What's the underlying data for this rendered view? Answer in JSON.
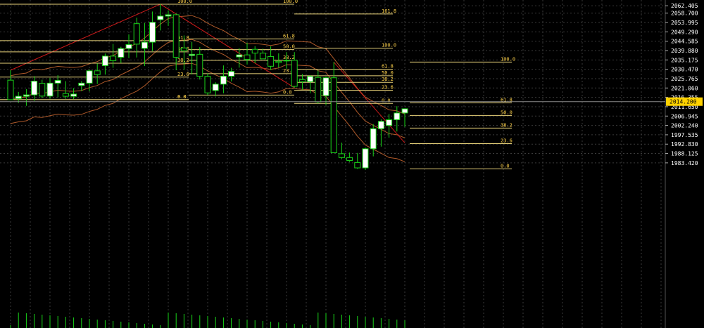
{
  "chart_data": {
    "type": "candlestick",
    "title": "",
    "grid": true,
    "colors": {
      "background": "#000000",
      "grid": "#3a3a3a",
      "bull": "#ffffff",
      "bear": "#000000",
      "wick": "#19d419",
      "fib_line": "#e8d27a",
      "fib_text": "#ffd24a",
      "trend": "#cc1a1a",
      "bands": "#b05a2a",
      "volume": "#19d419",
      "price_tag": "#ffd200",
      "axis_text": "#ffffff"
    },
    "ylim": [
      1900.4,
      2065.3
    ],
    "y_ticks": [
      "2062.405",
      "2058.700",
      "2053.995",
      "2049.290",
      "2044.585",
      "2039.880",
      "2035.175",
      "2030.470",
      "2025.765",
      "2021.060",
      "2016.355",
      "2011.650",
      "2006.945",
      "2002.240",
      "1997.535",
      "1992.830",
      "1988.125",
      "1983.420"
    ],
    "y_tick_values": [
      2062.405,
      2058.7,
      2053.995,
      2049.29,
      2044.585,
      2039.88,
      2035.175,
      2030.47,
      2025.765,
      2021.06,
      2016.355,
      2011.65,
      2006.945,
      2002.24,
      1997.535,
      1992.83,
      1988.125,
      1983.42
    ],
    "current_price": "2014.200",
    "current_price_value": 2014.2,
    "candles": [
      {
        "o": 2025.0,
        "h": 2030.0,
        "l": 2015.2,
        "c": 2015.2
      },
      {
        "o": 2015.7,
        "h": 2019.1,
        "l": 2013.5,
        "c": 2016.9
      },
      {
        "o": 2016.9,
        "h": 2020.5,
        "l": 2012.1,
        "c": 2017.6
      },
      {
        "o": 2017.6,
        "h": 2027.0,
        "l": 2014.6,
        "c": 2024.5
      },
      {
        "o": 2023.4,
        "h": 2025.2,
        "l": 2015.9,
        "c": 2017.0
      },
      {
        "o": 2017.0,
        "h": 2026.0,
        "l": 2015.7,
        "c": 2023.5
      },
      {
        "o": 2023.5,
        "h": 2027.5,
        "l": 2016.4,
        "c": 2024.9
      },
      {
        "o": 2018.3,
        "h": 2024.5,
        "l": 2015.6,
        "c": 2016.9
      },
      {
        "o": 2016.9,
        "h": 2021.0,
        "l": 2015.5,
        "c": 2018.0
      },
      {
        "o": 2022.3,
        "h": 2024.5,
        "l": 2019.5,
        "c": 2023.5
      },
      {
        "o": 2023.5,
        "h": 2030.4,
        "l": 2019.4,
        "c": 2029.7
      },
      {
        "o": 2029.7,
        "h": 2033.4,
        "l": 2023.1,
        "c": 2027.8
      },
      {
        "o": 2032.3,
        "h": 2038.4,
        "l": 2027.8,
        "c": 2037.1
      },
      {
        "o": 2037.1,
        "h": 2043.2,
        "l": 2031.2,
        "c": 2034.8
      },
      {
        "o": 2036.5,
        "h": 2041.8,
        "l": 2033.6,
        "c": 2040.9
      },
      {
        "o": 2040.9,
        "h": 2048.0,
        "l": 2036.1,
        "c": 2042.9
      },
      {
        "o": 2053.4,
        "h": 2056.4,
        "l": 2036.4,
        "c": 2043.1
      },
      {
        "o": 2041.0,
        "h": 2053.7,
        "l": 2032.1,
        "c": 2044.1
      },
      {
        "o": 2044.1,
        "h": 2059.5,
        "l": 2039.6,
        "c": 2054.1
      },
      {
        "o": 2055.4,
        "h": 2063.2,
        "l": 2050.0,
        "c": 2057.2
      },
      {
        "o": 2057.2,
        "h": 2060.1,
        "l": 2052.3,
        "c": 2057.9
      },
      {
        "o": 2057.9,
        "h": 2058.5,
        "l": 2030.0,
        "c": 2036.5
      },
      {
        "o": 2041.2,
        "h": 2047.5,
        "l": 2030.2,
        "c": 2039.8
      },
      {
        "o": 2037.4,
        "h": 2044.2,
        "l": 2027.9,
        "c": 2038.0
      },
      {
        "o": 2038.0,
        "h": 2041.6,
        "l": 2025.3,
        "c": 2026.9
      },
      {
        "o": 2026.9,
        "h": 2028.5,
        "l": 2017.5,
        "c": 2018.6
      },
      {
        "o": 2019.8,
        "h": 2023.9,
        "l": 2016.8,
        "c": 2023.0
      },
      {
        "o": 2023.0,
        "h": 2032.4,
        "l": 2018.4,
        "c": 2027.0
      },
      {
        "o": 2027.0,
        "h": 2031.2,
        "l": 2024.4,
        "c": 2029.4
      },
      {
        "o": 2036.7,
        "h": 2041.1,
        "l": 2031.3,
        "c": 2037.7
      },
      {
        "o": 2037.7,
        "h": 2043.8,
        "l": 2032.9,
        "c": 2035.4
      },
      {
        "o": 2040.5,
        "h": 2042.1,
        "l": 2033.5,
        "c": 2038.6
      },
      {
        "o": 2038.6,
        "h": 2040.9,
        "l": 2035.6,
        "c": 2035.7
      },
      {
        "o": 2036.9,
        "h": 2042.0,
        "l": 2030.1,
        "c": 2032.0
      },
      {
        "o": 2034.5,
        "h": 2038.5,
        "l": 2031.3,
        "c": 2033.9
      },
      {
        "o": 2034.8,
        "h": 2039.1,
        "l": 2030.8,
        "c": 2035.0
      },
      {
        "o": 2035.0,
        "h": 2039.1,
        "l": 2021.2,
        "c": 2021.9
      },
      {
        "o": 2025.3,
        "h": 2028.1,
        "l": 2020.1,
        "c": 2024.2
      },
      {
        "o": 2024.2,
        "h": 2027.5,
        "l": 2018.4,
        "c": 2026.9
      },
      {
        "o": 2026.4,
        "h": 2029.9,
        "l": 2013.3,
        "c": 2014.1
      },
      {
        "o": 2017.2,
        "h": 2026.7,
        "l": 2012.5,
        "c": 2026.2
      },
      {
        "o": 2026.2,
        "h": 2034.1,
        "l": 2018.6,
        "c": 1988.5
      },
      {
        "o": 1988.0,
        "h": 1993.6,
        "l": 1985.2,
        "c": 1986.1
      },
      {
        "o": 1986.1,
        "h": 1988.6,
        "l": 1983.9,
        "c": 1984.6
      },
      {
        "o": 1983.6,
        "h": 1988.4,
        "l": 1980.4,
        "c": 1980.9
      },
      {
        "o": 1980.9,
        "h": 1991.1,
        "l": 1979.8,
        "c": 1990.5
      },
      {
        "o": 1990.5,
        "h": 2002.9,
        "l": 1986.7,
        "c": 2000.6
      },
      {
        "o": 2000.6,
        "h": 2005.3,
        "l": 1991.6,
        "c": 2004.3
      },
      {
        "o": 2002.2,
        "h": 2008.0,
        "l": 1996.1,
        "c": 2005.1
      },
      {
        "o": 2005.1,
        "h": 2011.9,
        "l": 1999.2,
        "c": 2008.5
      },
      {
        "o": 2008.5,
        "h": 2010.8,
        "l": 2001.5,
        "c": 2010.6
      }
    ],
    "fib_labels": {
      "set1": [
        "100.0",
        "61.8",
        "50.0",
        "38.2",
        "23.6",
        "0.0",
        "0.0"
      ],
      "set2": [
        "161.8",
        "100.0",
        "61.8",
        "50.0",
        "38.2",
        "23.6",
        "0.0"
      ],
      "set3": [
        "161.8",
        "100.0",
        "61.8",
        "50.0",
        "38.2",
        "23.6",
        "0.0"
      ],
      "set4": [
        "161.8",
        "100.0",
        "61.8",
        "50.0",
        "38.2",
        "23.6",
        "0.0"
      ]
    }
  }
}
